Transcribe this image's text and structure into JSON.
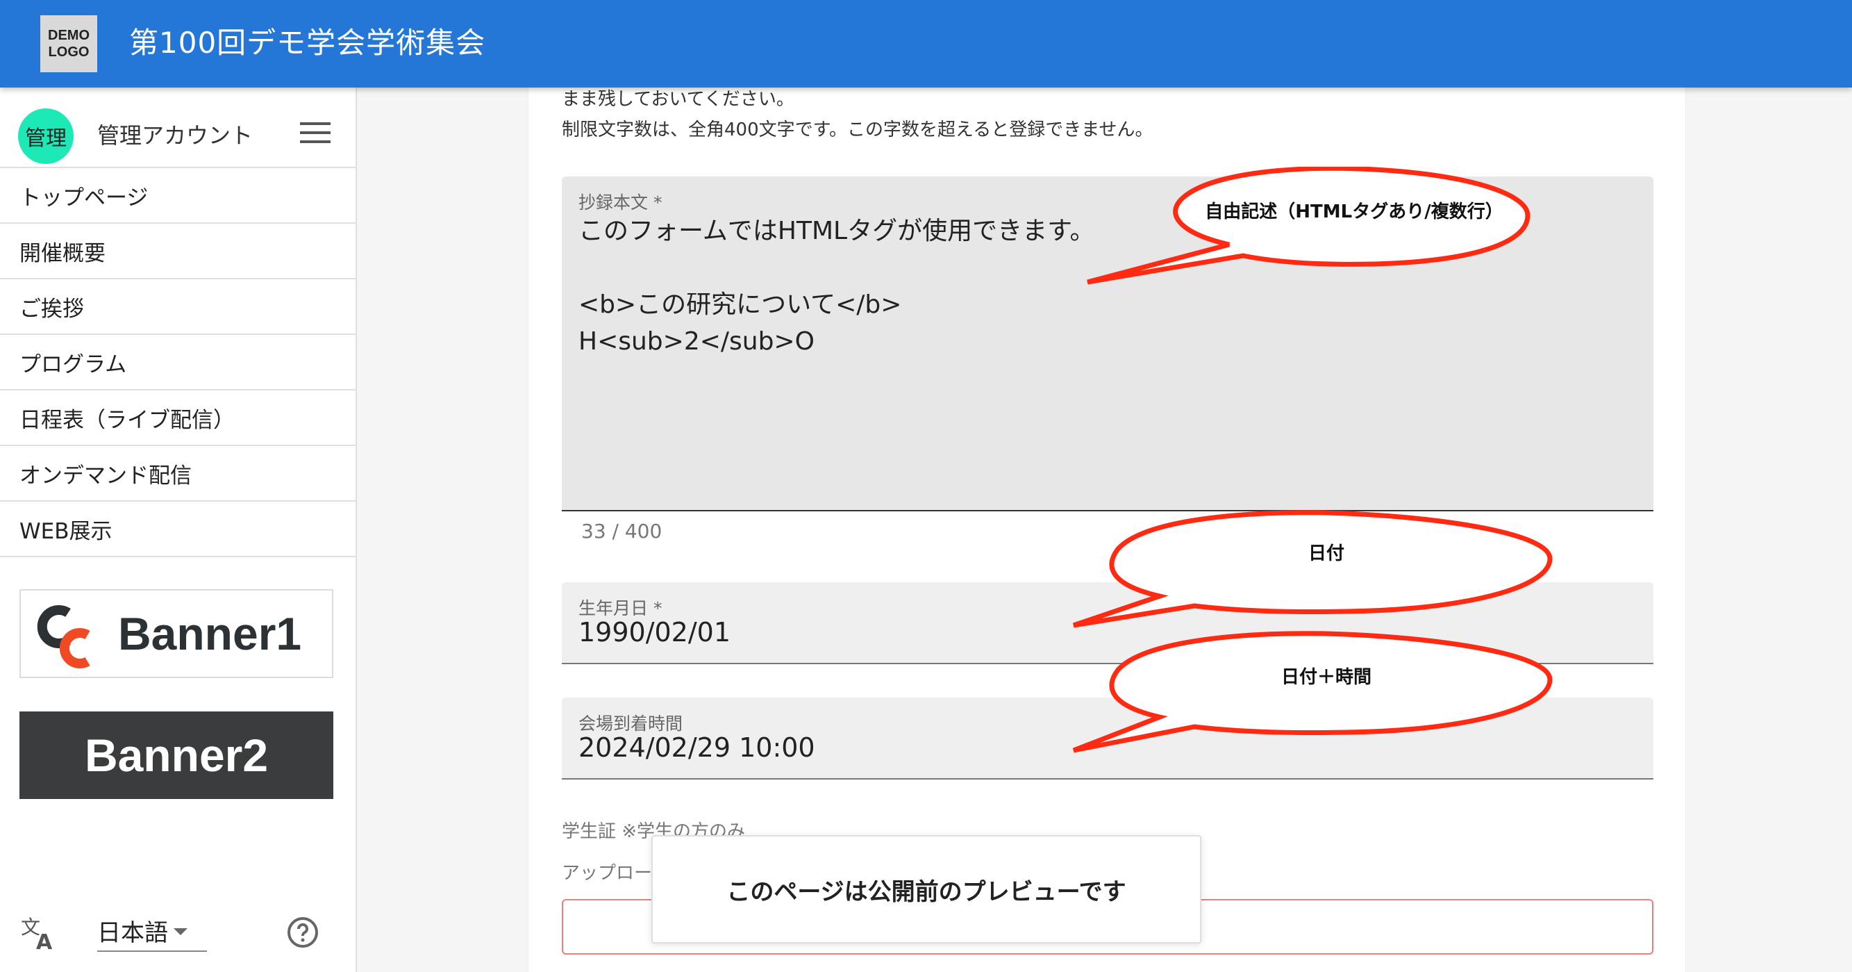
{
  "header": {
    "logo_text": "DEMO\nLOGO",
    "title": "第100回デモ学会学術集会",
    "bg_color": "#2477d6"
  },
  "sidebar": {
    "avatar_text": "管理",
    "avatar_color": "#1de9b6",
    "account_name": "管理アカウント",
    "menu_icon": "hamburger-menu-icon",
    "nav_items": [
      {
        "label": "トップページ"
      },
      {
        "label": "開催概要"
      },
      {
        "label": "ご挨拶"
      },
      {
        "label": "プログラム"
      },
      {
        "label": "日程表（ライブ配信）"
      },
      {
        "label": "オンデマンド配信"
      },
      {
        "label": "WEB展示"
      }
    ],
    "banner1_label": "Banner1",
    "banner2_label": "Banner2",
    "language": "日本語",
    "translate_icon": "translate-icon",
    "help_icon": "help-circle-icon"
  },
  "form": {
    "helper_line1": "まま残しておいてください。",
    "helper_line2": "制限文字数は、全角400文字です。この字数を超えると登録できません。",
    "abstract": {
      "label": "抄録本文 *",
      "value": "このフォームではHTMLタグが使用できます。\n\n<b>この研究について</b>\nH<sub>2</sub>O",
      "counter": "33 / 400"
    },
    "birthdate": {
      "label": "生年月日 *",
      "value": "1990/02/01"
    },
    "arrival_time": {
      "label": "会場到着時間",
      "value": "2024/02/29 10:00"
    },
    "student_id_label": "学生証 ※学生の方のみ",
    "upload_label": "アップロー"
  },
  "callouts": {
    "textarea": "自由記述（HTMLタグあり/複数行）",
    "date": "日付",
    "datetime": "日付＋時間",
    "color": "#ff2a12"
  },
  "toast": {
    "message": "このページは公開前のプレビューです"
  }
}
